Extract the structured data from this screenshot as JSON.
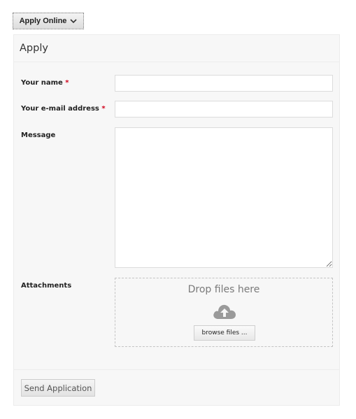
{
  "toggle": {
    "label": "Apply Online",
    "icon": "chevron-down-icon"
  },
  "panel": {
    "title": "Apply"
  },
  "form": {
    "name_label": "Your name",
    "email_label": "Your e-mail address",
    "required_mark": "*",
    "message_label": "Message",
    "attachments_label": "Attachments",
    "name_value": "",
    "email_value": "",
    "message_value": ""
  },
  "dropzone": {
    "text": "Drop files here",
    "icon": "cloud-upload-icon",
    "browse_label": "browse files ..."
  },
  "footer": {
    "send_label": "Send Application"
  },
  "colors": {
    "required": "#d0021b",
    "panel_bg": "#f7f7f7"
  }
}
